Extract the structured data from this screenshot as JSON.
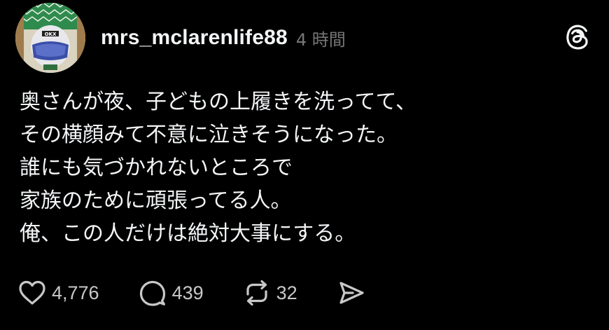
{
  "post": {
    "username": "mrs_mclarenlife88",
    "timestamp": "4 時間",
    "lines": [
      "奥さんが夜、子どもの上履きを洗ってて、",
      "その横顔みて不意に泣きそうになった。",
      "誰にも気づかれないところで",
      "家族のために頑張ってる人。",
      "俺、この人だけは絶対大事にする。"
    ],
    "avatar_icon": "helmet-avatar",
    "app_icon": "threads-logo-icon"
  },
  "actions": {
    "like_count": "4,776",
    "reply_count": "439",
    "repost_count": "32",
    "like_icon": "heart-icon",
    "reply_icon": "comment-bubble-icon",
    "repost_icon": "repost-arrows-icon",
    "share_icon": "send-icon"
  },
  "colors": {
    "background": "#000000",
    "text": "#f3f5f7",
    "muted": "#777777",
    "count": "#c8c8c8"
  }
}
